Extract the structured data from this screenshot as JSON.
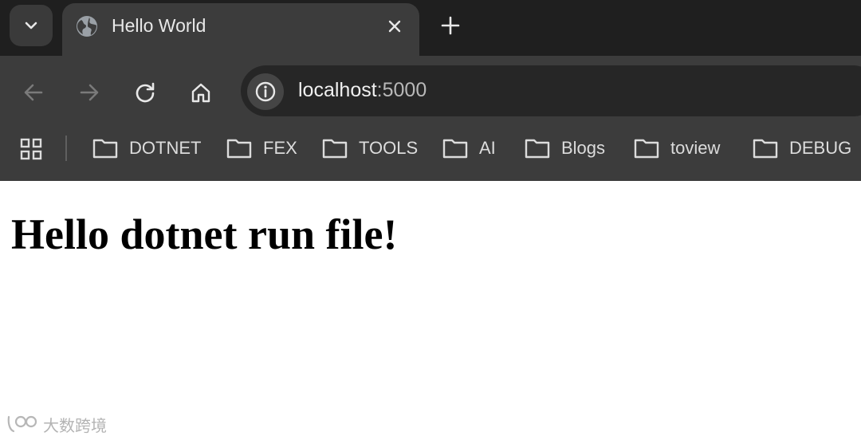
{
  "tab": {
    "title": "Hello World",
    "favicon": "globe-icon"
  },
  "address_bar": {
    "host": "localhost",
    "port": ":5000"
  },
  "bookmarks": [
    {
      "label": "DOTNET",
      "icon": "folder-icon"
    },
    {
      "label": "FEX",
      "icon": "folder-icon"
    },
    {
      "label": "TOOLS",
      "icon": "folder-icon"
    },
    {
      "label": "AI",
      "icon": "folder-icon"
    },
    {
      "label": "Blogs",
      "icon": "folder-icon"
    },
    {
      "label": "toview",
      "icon": "folder-icon"
    },
    {
      "label": "DEBUG",
      "icon": "folder-icon"
    }
  ],
  "page": {
    "heading": "Hello dotnet run file!"
  },
  "watermark": {
    "text": "大数跨境"
  },
  "colors": {
    "tabstrip": "#1f1f1f",
    "toolbar": "#3c3c3c",
    "omnibox": "#262626",
    "text_light": "#e8e8e8",
    "page_bg": "#ffffff"
  }
}
